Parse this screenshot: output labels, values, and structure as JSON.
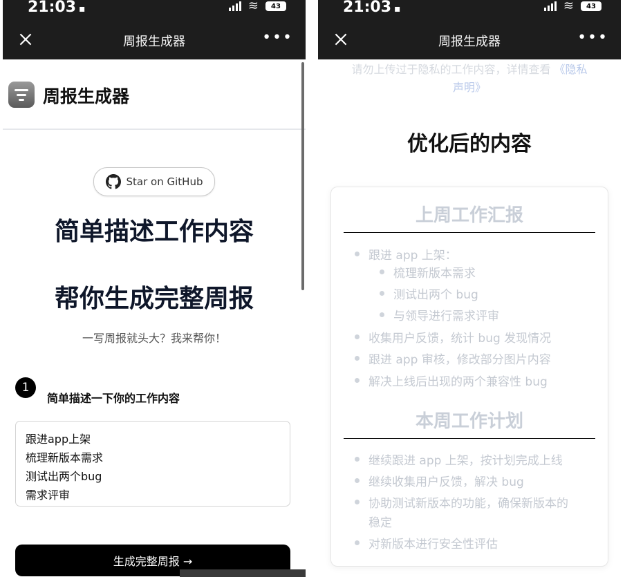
{
  "status_bar": {
    "time": "21:03",
    "battery": "43"
  },
  "navbar": {
    "title": "周报生成器"
  },
  "left": {
    "app_name": "周报生成器",
    "github_label": "Star on GitHub",
    "hero_line1": "简单描述工作内容",
    "hero_line2": "帮你生成完整周报",
    "subtitle": "一写周报就头大？我来帮你！",
    "step_number": "1",
    "step_label": "简单描述一下你的工作内容",
    "input_lines": [
      "跟进app上架",
      "梳理新版本需求",
      "测试出两个bug",
      "需求评审"
    ],
    "generate_button": "生成完整周报 →"
  },
  "right": {
    "privacy_line1": "请勿上传过于隐私的工作内容，详情查看",
    "privacy_link1": "《隐私",
    "privacy_link2": "声明》",
    "result_title": "优化后的内容",
    "last_week": {
      "title": "上周工作汇报",
      "items": [
        "跟进 app 上架：",
        "梳理新版本需求",
        "测试出两个 bug",
        "与领导进行需求评审",
        "收集用户反馈，统计 bug 发现情况",
        "跟进 app 审核，修改部分图片内容",
        "解决上线后出现的两个兼容性 bug"
      ]
    },
    "this_week": {
      "title": "本周工作计划",
      "items": [
        "继续跟进 app 上架，按计划完成上线",
        "继续收集用户反馈，解决 bug",
        "协助测试新版本的功能，确保新版本的",
        "稳定",
        "对新版本进行安全性评估"
      ]
    }
  },
  "colors": {
    "navbar_bg": "#1d1d1d",
    "accent": "#000000",
    "muted_text": "#c4c9d1"
  }
}
